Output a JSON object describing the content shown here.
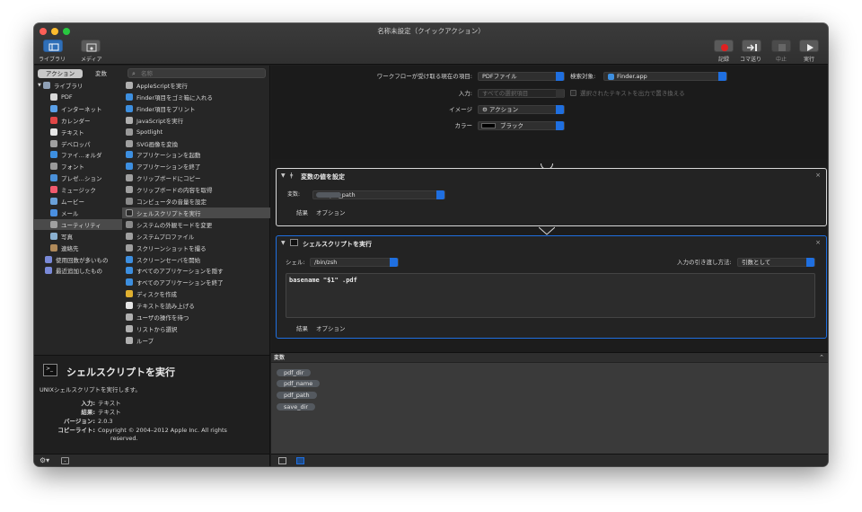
{
  "window": {
    "title": "名称未設定（クイックアクション）"
  },
  "toolbar": {
    "library_label": "ライブラリ",
    "media_label": "メディア",
    "record_label": "記録",
    "step_label": "コマ送り",
    "stop_label": "中止",
    "run_label": "実行"
  },
  "left": {
    "tab_actions": "アクション",
    "tab_variables": "変数",
    "search_placeholder": "名称",
    "library_items": [
      {
        "label": "ライブラリ",
        "icon": "library-icon",
        "color": "#8fa0b5"
      },
      {
        "label": "PDF",
        "icon": "pdf-icon",
        "color": "#d9d9d9"
      },
      {
        "label": "インターネット",
        "icon": "globe-icon",
        "color": "#5aa0e8"
      },
      {
        "label": "カレンダー",
        "icon": "calendar-icon",
        "color": "#e04646"
      },
      {
        "label": "テキスト",
        "icon": "text-icon",
        "color": "#e6e6e6"
      },
      {
        "label": "デベロッパ",
        "icon": "tools-icon",
        "color": "#a0a0a0"
      },
      {
        "label": "ファイ…ォルダ",
        "icon": "finder-icon",
        "color": "#3d8fe0"
      },
      {
        "label": "フォント",
        "icon": "font-icon",
        "color": "#9a9a9a"
      },
      {
        "label": "プレゼ…ション",
        "icon": "presentation-icon",
        "color": "#4a90d9"
      },
      {
        "label": "ミュージック",
        "icon": "music-icon",
        "color": "#f05a6e"
      },
      {
        "label": "ムービー",
        "icon": "movie-icon",
        "color": "#6aa0d8"
      },
      {
        "label": "メール",
        "icon": "mail-icon",
        "color": "#4a8fe0"
      },
      {
        "label": "ユーティリティ",
        "icon": "utility-icon",
        "color": "#a0a0a0"
      },
      {
        "label": "写真",
        "icon": "photo-icon",
        "color": "#8ab0d0"
      },
      {
        "label": "連絡先",
        "icon": "contacts-icon",
        "color": "#b08a5a"
      },
      {
        "label": "使用回数が多いもの",
        "icon": "smart-folder-icon",
        "color": "#7a8ad8"
      },
      {
        "label": "最近追加したもの",
        "icon": "smart-folder-icon",
        "color": "#7a8ad8"
      }
    ],
    "action_items": [
      {
        "label": "AppleScriptを実行",
        "icon": "script-icon",
        "color": "#b0b0b0"
      },
      {
        "label": "Finder項目をゴミ箱に入れる",
        "icon": "finder-icon",
        "color": "#3d8fe0"
      },
      {
        "label": "Finder項目をプリント",
        "icon": "finder-icon",
        "color": "#3d8fe0"
      },
      {
        "label": "JavaScriptを実行",
        "icon": "script-icon",
        "color": "#b0b0b0"
      },
      {
        "label": "Spotlight",
        "icon": "spotlight-icon",
        "color": "#9a9a9a"
      },
      {
        "label": "SVG画像を変換",
        "icon": "svg-icon",
        "color": "#a0a0a0"
      },
      {
        "label": "アプリケーションを起動",
        "icon": "finder-icon",
        "color": "#3d8fe0"
      },
      {
        "label": "アプリケーションを終了",
        "icon": "finder-icon",
        "color": "#3d8fe0"
      },
      {
        "label": "クリップボードにコピー",
        "icon": "tools-icon",
        "color": "#a0a0a0"
      },
      {
        "label": "クリップボードの内容を取得",
        "icon": "tools-icon",
        "color": "#a0a0a0"
      },
      {
        "label": "コンピュータの音量を設定",
        "icon": "volume-icon",
        "color": "#8a8a8a"
      },
      {
        "label": "シェルスクリプトを実行",
        "icon": "terminal-icon",
        "color": "#2a2a2a"
      },
      {
        "label": "システムの外観モードを変更",
        "icon": "appearance-icon",
        "color": "#8a8a8a"
      },
      {
        "label": "システムプロファイル",
        "icon": "tools-icon",
        "color": "#a0a0a0"
      },
      {
        "label": "スクリーンショットを撮る",
        "icon": "tools-icon",
        "color": "#a0a0a0"
      },
      {
        "label": "スクリーンセーバを開始",
        "icon": "screensaver-icon",
        "color": "#3d8fe0"
      },
      {
        "label": "すべてのアプリケーションを隠す",
        "icon": "finder-icon",
        "color": "#3d8fe0"
      },
      {
        "label": "すべてのアプリケーションを終了",
        "icon": "finder-icon",
        "color": "#3d8fe0"
      },
      {
        "label": "ディスクを作成",
        "icon": "disk-icon",
        "color": "#e0b030"
      },
      {
        "label": "テキストを読み上げる",
        "icon": "text-icon",
        "color": "#e6e6e6"
      },
      {
        "label": "ユーザの操作を待つ",
        "icon": "script-icon",
        "color": "#b0b0b0"
      },
      {
        "label": "リストから選択",
        "icon": "script-icon",
        "color": "#b0b0b0"
      },
      {
        "label": "ループ",
        "icon": "script-icon",
        "color": "#b0b0b0"
      }
    ],
    "description": {
      "title": "シェルスクリプトを実行",
      "summary": "UNIXシェルスクリプトを実行します。",
      "input_key": "入力:",
      "input_val": "テキスト",
      "result_key": "結果:",
      "result_val": "テキスト",
      "version_key": "バージョン:",
      "version_val": "2.0.3",
      "copyright_key": "コピーライト:",
      "copyright_val1": "Copyright © 2004–2012 Apple Inc.  All rights",
      "copyright_val2": "reserved."
    }
  },
  "workflow": {
    "receives_label": "ワークフローが受け取る現在の項目:",
    "receives_value": "PDFファイル",
    "search_target_label": "検索対象:",
    "search_target_value": "Finder.app",
    "input_label": "入力:",
    "input_value": "すべての選択項目",
    "replace_text_label": "選択されたテキストを出力で置き換える",
    "image_label": "イメージ",
    "image_value": "⚙ アクション",
    "color_label": "カラー",
    "color_value": "ブラック"
  },
  "actions": [
    {
      "title": "変数の値を設定",
      "var_label": "変数:",
      "var_value": "pdf_path",
      "results_tab": "結果",
      "options_tab": "オプション"
    },
    {
      "title": "シェルスクリプトを実行",
      "shell_label": "シェル:",
      "shell_value": "/bin/zsh",
      "pass_input_label": "入力の引き渡し方法:",
      "pass_input_value": "引数として",
      "script": "basename \"$1\" .pdf",
      "results_tab": "結果",
      "options_tab": "オプション"
    }
  ],
  "variables": {
    "header": "変数",
    "items": [
      "pdf_dir",
      "pdf_name",
      "pdf_path",
      "save_dir"
    ]
  },
  "colors": {
    "accent": "#1f6fe0",
    "record": "#e02020"
  }
}
